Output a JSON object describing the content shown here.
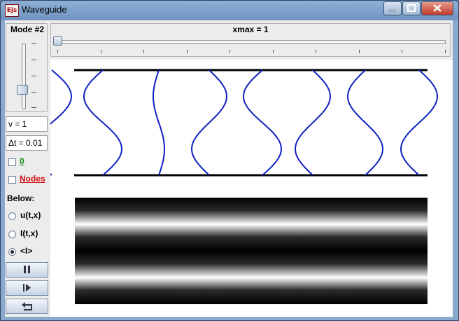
{
  "window": {
    "title": "Waveguide",
    "icon_text": "Ejs"
  },
  "mode": {
    "label": "Mode #2",
    "fraction": 0.25
  },
  "xmax": {
    "label": "xmax = 1",
    "fraction": 0.0
  },
  "fields": {
    "v": "v = 1",
    "dt": "Δt = 0.01"
  },
  "checks": [
    {
      "label": "0",
      "color": "#0a8a0a",
      "checked": false
    },
    {
      "label": "Nodes",
      "color": "#d01010",
      "checked": false
    }
  ],
  "below": {
    "label": "Below:",
    "options": [
      {
        "label": "u(t,x)",
        "selected": false
      },
      {
        "label": "I(t,x)",
        "selected": false
      },
      {
        "label": "<I>",
        "selected": true
      }
    ]
  },
  "buttons": {
    "pause": "pause-icon",
    "step": "step-forward-icon",
    "reset": "reset-icon"
  },
  "plot": {
    "line_color": "#1020c0",
    "guide_color": "#000000"
  }
}
